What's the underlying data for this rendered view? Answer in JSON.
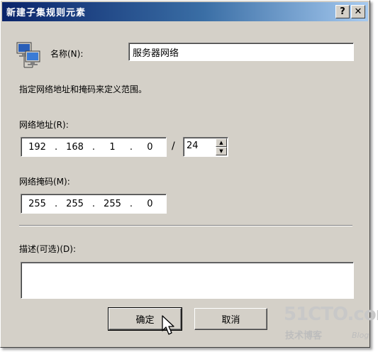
{
  "window": {
    "title": "新建子集规则元素",
    "help_label": "?",
    "close_label": "✕"
  },
  "icon": "network-computers-icon",
  "name": {
    "label": "名称(N):",
    "value": "服务器网络"
  },
  "description_text": "指定网络地址和掩码来定义范围。",
  "network_address": {
    "label": "网络地址(R):",
    "octets": [
      "192",
      "168",
      "1",
      "0"
    ],
    "slash": "/",
    "prefix": "24"
  },
  "network_mask": {
    "label": "网络掩码(M):",
    "octets": [
      "255",
      "255",
      "255",
      "0"
    ]
  },
  "description": {
    "label": "描述(可选)(D):",
    "value": ""
  },
  "buttons": {
    "ok": "确定",
    "cancel": "取消"
  },
  "watermark": {
    "logo": "51CTO.com",
    "sub": "技术博客",
    "blog": "Blog"
  }
}
